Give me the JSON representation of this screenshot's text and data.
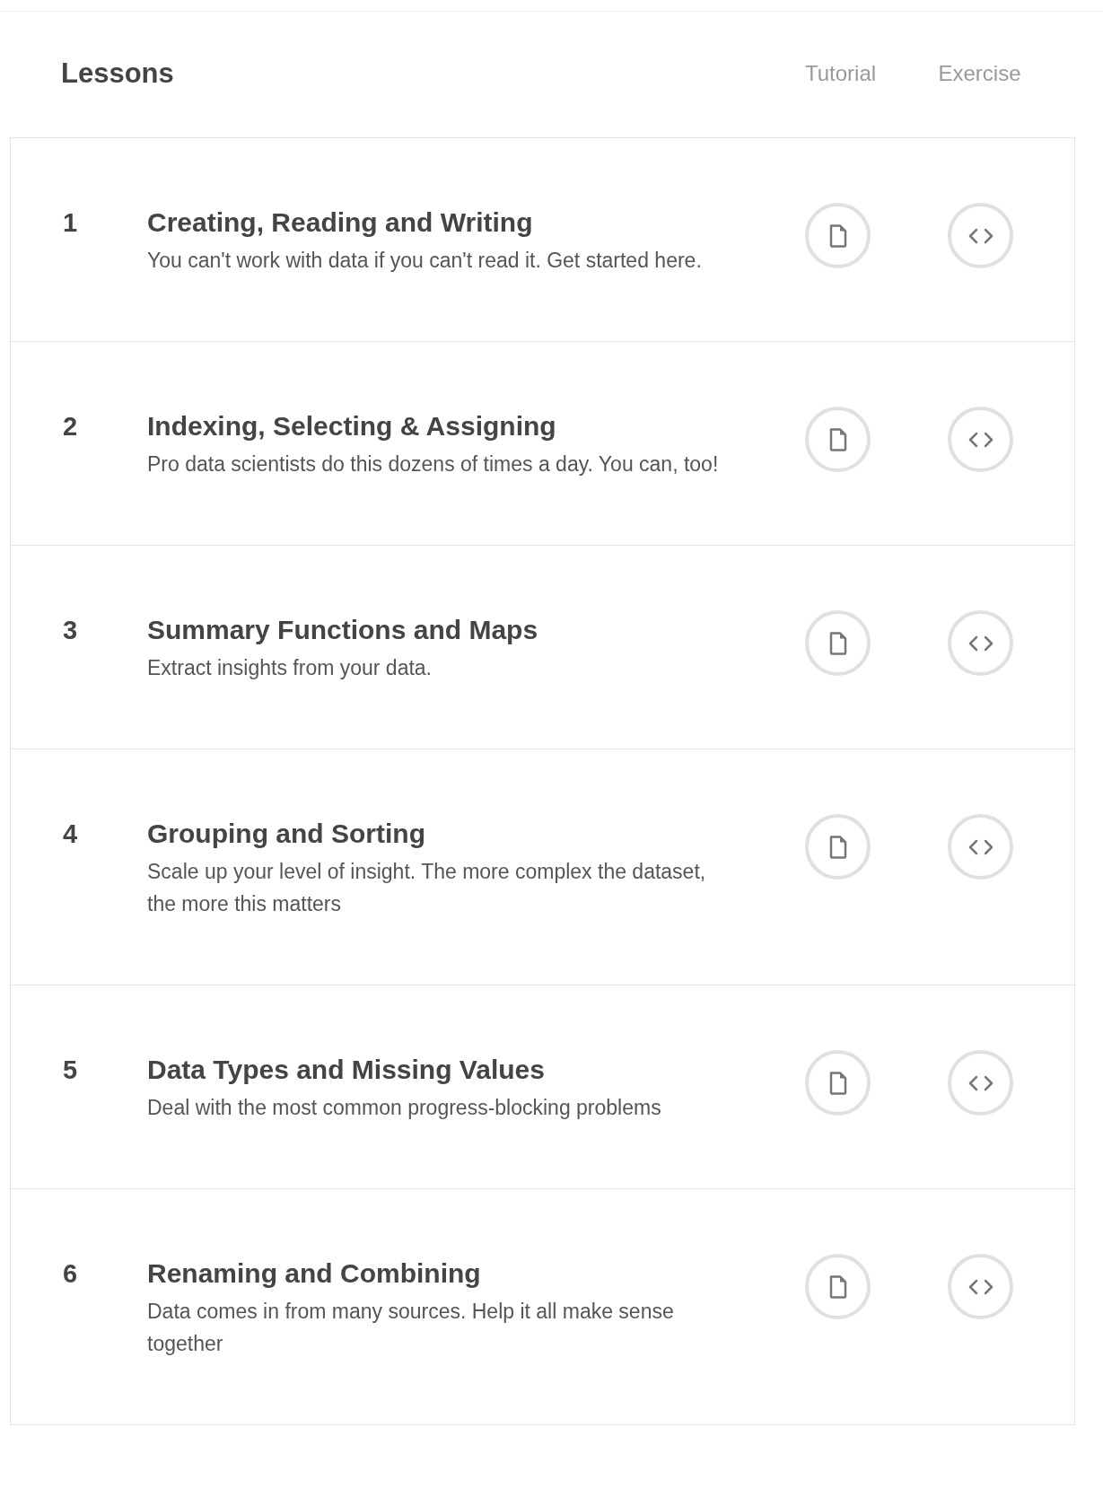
{
  "header": {
    "title": "Lessons",
    "columns": [
      "Tutorial",
      "Exercise"
    ]
  },
  "lessons": [
    {
      "number": "1",
      "title": "Creating, Reading and Writing",
      "description": "You can't work with data if you can't read it. Get started here."
    },
    {
      "number": "2",
      "title": "Indexing, Selecting & Assigning",
      "description": "Pro data scientists do this dozens of times a day. You can, too!"
    },
    {
      "number": "3",
      "title": "Summary Functions and Maps",
      "description": "Extract insights from your data."
    },
    {
      "number": "4",
      "title": "Grouping and Sorting",
      "description": "Scale up your level of insight. The more complex the dataset, the more this matters"
    },
    {
      "number": "5",
      "title": "Data Types and Missing Values",
      "description": "Deal with the most common progress-blocking problems"
    },
    {
      "number": "6",
      "title": "Renaming and Combining",
      "description": "Data comes in from many sources. Help it all make sense together"
    }
  ]
}
